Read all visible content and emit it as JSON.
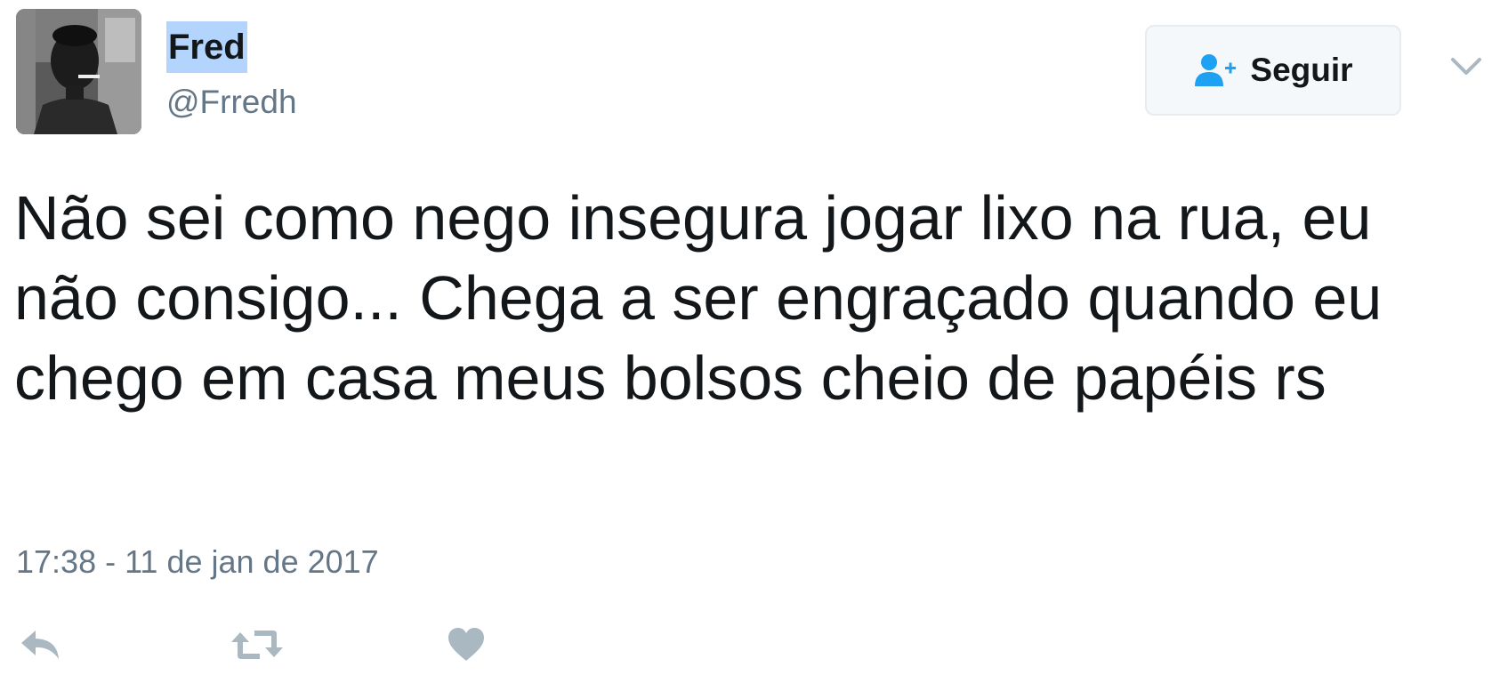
{
  "user": {
    "display_name": "Fred",
    "handle": "@Frredh"
  },
  "follow_button": {
    "label": "Seguir",
    "icon": "user-follow-icon"
  },
  "tweet": {
    "text": "Não sei como nego insegura jogar lixo na rua, eu não consigo... Chega a ser engraçado quando eu chego em casa meus bolsos cheio de papéis rs",
    "timestamp": "17:38 - 11 de jan de 2017"
  },
  "actions": [
    {
      "icon": "reply-icon"
    },
    {
      "icon": "retweet-icon"
    },
    {
      "icon": "heart-icon"
    }
  ],
  "colors": {
    "accent": "#1da1f2",
    "secondary_text": "#657786",
    "action_icon": "#aab8c2",
    "selection_highlight": "#b3d4fc",
    "button_background": "#f5f8fa",
    "button_border": "#e6ecf0"
  }
}
